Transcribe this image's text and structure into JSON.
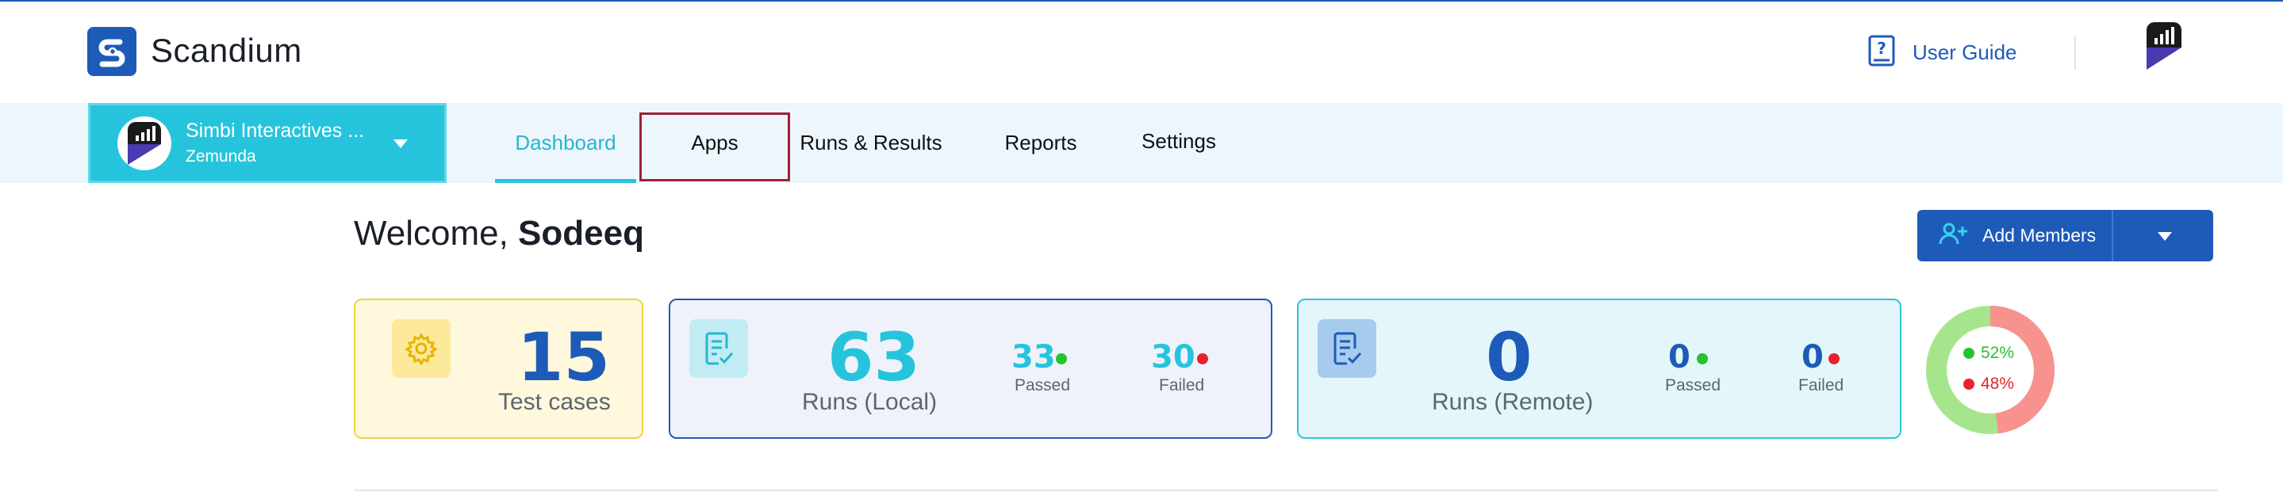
{
  "app": {
    "name": "Scandium"
  },
  "header": {
    "user_guide_label": "User Guide"
  },
  "org": {
    "name": "Simbi Interactives ...",
    "subtitle": "Zemunda"
  },
  "tabs": [
    {
      "label": "Dashboard",
      "active": true
    },
    {
      "label": "Apps",
      "active": false
    },
    {
      "label": "Runs & Results",
      "active": false
    },
    {
      "label": "Reports",
      "active": false
    },
    {
      "label": "Settings",
      "active": false
    }
  ],
  "welcome": {
    "greeting": "Welcome,",
    "username": "Sodeeq"
  },
  "add_members": {
    "label": "Add Members"
  },
  "cards": {
    "test_cases": {
      "value": "15",
      "label": "Test cases"
    },
    "runs_local": {
      "value": "63",
      "label": "Runs (Local)",
      "passed": "33",
      "passed_label": "Passed",
      "failed": "30",
      "failed_label": "Failed"
    },
    "runs_remote": {
      "value": "0",
      "label": "Runs (Remote)",
      "passed": "0",
      "passed_label": "Passed",
      "failed": "0",
      "failed_label": "Failed"
    }
  },
  "donut": {
    "passed_pct": 52,
    "failed_pct": 48,
    "passed_label": "52%",
    "failed_label": "48%"
  },
  "colors": {
    "primary": "#1e5bb8",
    "accent": "#26c4dc",
    "passed": "#22c42b",
    "failed": "#e8212b",
    "donut_pass": "#a6e58c",
    "donut_fail": "#f7928f"
  },
  "icons": {
    "logo": "scandium-logo-icon",
    "guide": "question-book-icon",
    "settings": "gear-icon",
    "runs_local": "checklist-icon",
    "runs_remote": "checklist-icon",
    "add_members": "user-plus-icon"
  }
}
